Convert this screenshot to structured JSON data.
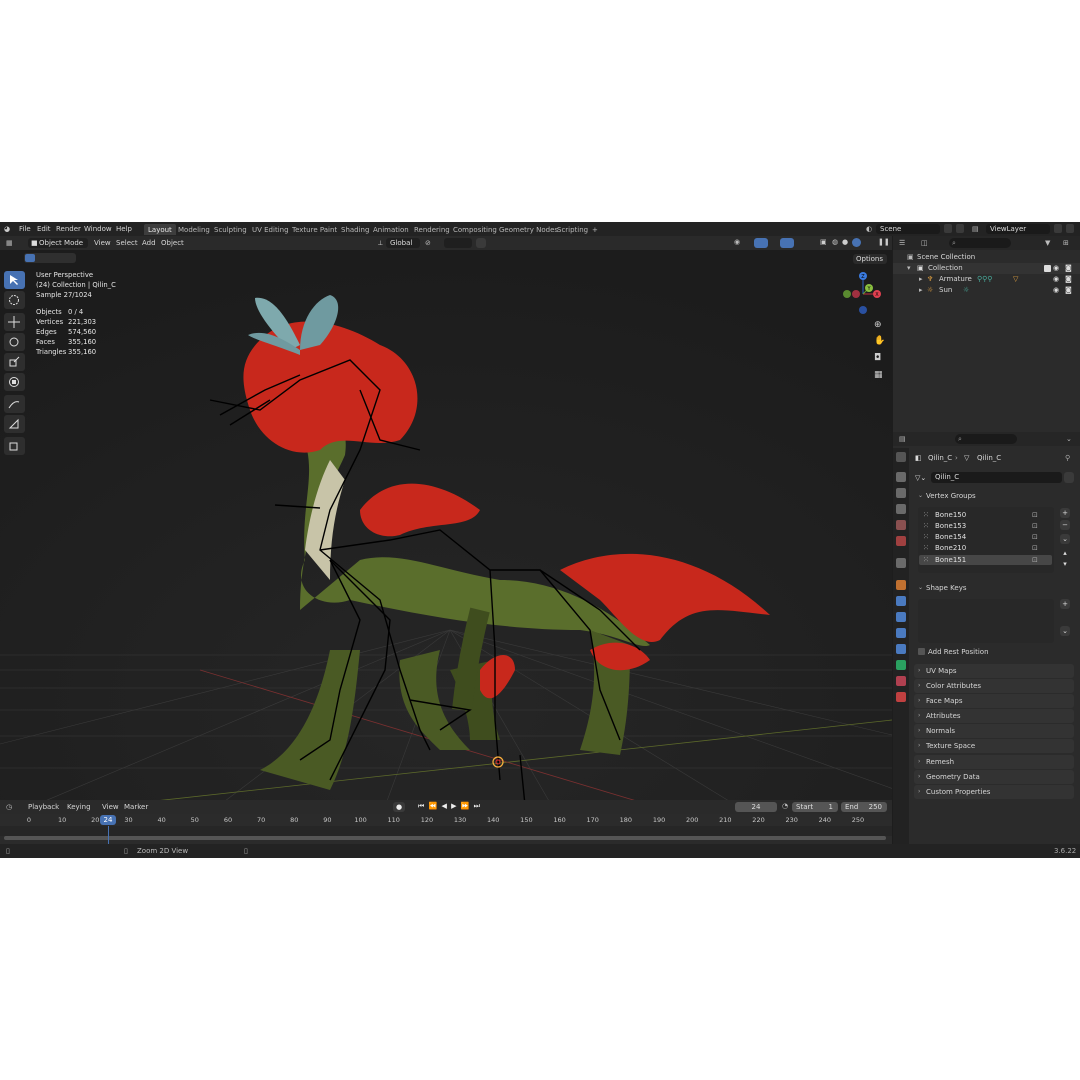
{
  "app": {
    "menu": [
      "File",
      "Edit",
      "Render",
      "Window",
      "Help"
    ],
    "workspaces": [
      "Layout",
      "Modeling",
      "Sculpting",
      "UV Editing",
      "Texture Paint",
      "Shading",
      "Animation",
      "Rendering",
      "Compositing",
      "Geometry Nodes",
      "Scripting"
    ],
    "active_workspace": "Layout",
    "add_tab": "+",
    "scene": "Scene",
    "view_layer": "ViewLayer",
    "version": "3.6.22"
  },
  "viewport_header": {
    "mode": "Object Mode",
    "menus": [
      "View",
      "Select",
      "Add",
      "Object"
    ],
    "orientation": "Global",
    "options": "Options"
  },
  "stats": {
    "view": "User Perspective",
    "collection": "(24) Collection | Qilin_C",
    "sample": "Sample 27/1024",
    "rows": [
      {
        "k": "Objects",
        "v": "0 / 4"
      },
      {
        "k": "Vertices",
        "v": "221,303"
      },
      {
        "k": "Edges",
        "v": "574,560"
      },
      {
        "k": "Faces",
        "v": "355,160"
      },
      {
        "k": "Triangles",
        "v": "355,160"
      }
    ]
  },
  "gizmo": {
    "z": "Z",
    "y": "Y",
    "x": "X"
  },
  "outliner": {
    "scene_collection": "Scene Collection",
    "collection": "Collection",
    "items": [
      "Armature",
      "Sun"
    ]
  },
  "properties": {
    "breadcrumb_object": "Qilin_C",
    "breadcrumb_mesh": "Qilin_C",
    "mesh_name": "Qilin_C",
    "vertex_groups_title": "Vertex Groups",
    "vertex_groups": [
      "Bone150",
      "Bone153",
      "Bone154",
      "Bone210",
      "Bone151"
    ],
    "shape_keys_title": "Shape Keys",
    "add_rest_position": "Add Rest Position",
    "panels": [
      "UV Maps",
      "Color Attributes",
      "Face Maps",
      "Attributes",
      "Normals",
      "Texture Space",
      "Remesh",
      "Geometry Data",
      "Custom Properties"
    ]
  },
  "timeline": {
    "menus": [
      "Playback",
      "Keying",
      "View",
      "Marker"
    ],
    "current_frame": "24",
    "start_label": "Start",
    "start": "1",
    "end_label": "End",
    "end": "250",
    "ticks": [
      "0",
      "10",
      "20",
      "30",
      "40",
      "50",
      "60",
      "70",
      "80",
      "90",
      "100",
      "110",
      "120",
      "130",
      "140",
      "150",
      "160",
      "170",
      "180",
      "190",
      "200",
      "210",
      "220",
      "230",
      "240",
      "250"
    ],
    "frame_marker": "24"
  },
  "statusbar": {
    "hint": "Zoom 2D View"
  },
  "colors": {
    "accent": "#4772b3",
    "fur": "#c8281c",
    "body": "#56682c",
    "grid": "#3a3a3a"
  }
}
